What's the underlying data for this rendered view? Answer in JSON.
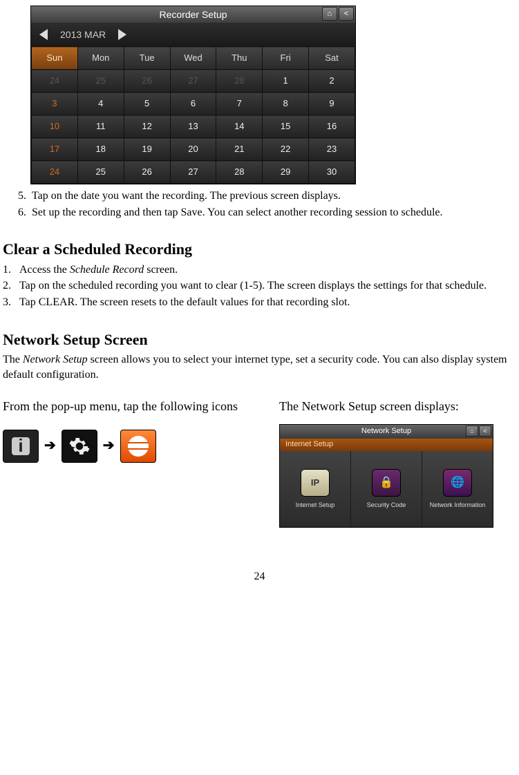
{
  "calendar": {
    "title": "Recorder Setup",
    "month_label": "2013 MAR",
    "day_headers": [
      "Sun",
      "Mon",
      "Tue",
      "Wed",
      "Thu",
      "Fri",
      "Sat"
    ],
    "rows": [
      [
        {
          "v": "24",
          "cls": "gray"
        },
        {
          "v": "25",
          "cls": "gray"
        },
        {
          "v": "26",
          "cls": "gray"
        },
        {
          "v": "27",
          "cls": "gray"
        },
        {
          "v": "28",
          "cls": "gray"
        },
        {
          "v": "1",
          "cls": ""
        },
        {
          "v": "2",
          "cls": ""
        }
      ],
      [
        {
          "v": "3",
          "cls": "orange"
        },
        {
          "v": "4",
          "cls": ""
        },
        {
          "v": "5",
          "cls": ""
        },
        {
          "v": "6",
          "cls": ""
        },
        {
          "v": "7",
          "cls": ""
        },
        {
          "v": "8",
          "cls": ""
        },
        {
          "v": "9",
          "cls": ""
        }
      ],
      [
        {
          "v": "10",
          "cls": "orange"
        },
        {
          "v": "11",
          "cls": ""
        },
        {
          "v": "12",
          "cls": ""
        },
        {
          "v": "13",
          "cls": ""
        },
        {
          "v": "14",
          "cls": ""
        },
        {
          "v": "15",
          "cls": ""
        },
        {
          "v": "16",
          "cls": ""
        }
      ],
      [
        {
          "v": "17",
          "cls": "orange"
        },
        {
          "v": "18",
          "cls": ""
        },
        {
          "v": "19",
          "cls": ""
        },
        {
          "v": "20",
          "cls": ""
        },
        {
          "v": "21",
          "cls": ""
        },
        {
          "v": "22",
          "cls": ""
        },
        {
          "v": "23",
          "cls": ""
        }
      ],
      [
        {
          "v": "24",
          "cls": "orange"
        },
        {
          "v": "25",
          "cls": ""
        },
        {
          "v": "26",
          "cls": ""
        },
        {
          "v": "27",
          "cls": ""
        },
        {
          "v": "28",
          "cls": ""
        },
        {
          "v": "29",
          "cls": ""
        },
        {
          "v": "30",
          "cls": ""
        }
      ]
    ]
  },
  "steps_a": [
    {
      "n": "5.",
      "t": "Tap on the date you want the recording. The previous screen displays."
    },
    {
      "n": "6.",
      "t": "Set up the recording and then tap Save. You can select another recording session to schedule."
    }
  ],
  "sec_clear": {
    "heading": "Clear a Scheduled Recording",
    "steps": [
      {
        "n": "1.",
        "pre": "Access the ",
        "it": "Schedule Record",
        "post": " screen."
      },
      {
        "n": "2.",
        "pre": "Tap on the scheduled recording you want to clear (1-5). The screen displays the settings for that schedule.",
        "it": "",
        "post": ""
      },
      {
        "n": "3.",
        "pre": "Tap CLEAR. The screen resets to the default values for that recording slot.",
        "it": "",
        "post": ""
      }
    ]
  },
  "sec_net": {
    "heading": "Network Setup Screen",
    "para_pre": "The ",
    "para_it": "Network Setup",
    "para_post": " screen allows you to select your internet type, set a security code. You can also display system default configuration."
  },
  "cols": {
    "left_text": "From the pop-up menu, tap the following icons",
    "right_text": "The Network Setup screen displays:",
    "arrow": "➔"
  },
  "netshot": {
    "title": "Network Setup",
    "tab": "Internet Setup",
    "items": [
      {
        "label": "Internet Setup",
        "cls": "ip",
        "txt": "IP"
      },
      {
        "label": "Security Code",
        "cls": "sec",
        "txt": ""
      },
      {
        "label": "Network Information",
        "cls": "info2",
        "txt": ""
      }
    ]
  },
  "page_number": "24"
}
